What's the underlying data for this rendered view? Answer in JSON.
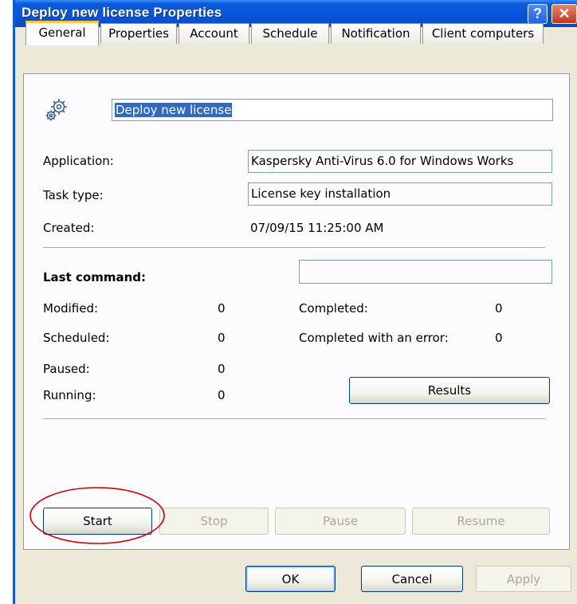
{
  "window": {
    "title": "Deploy new license Properties",
    "help_label": "?",
    "close_label": "✕"
  },
  "tabs": [
    {
      "label": "General",
      "active": true
    },
    {
      "label": "Properties"
    },
    {
      "label": "Account"
    },
    {
      "label": "Schedule"
    },
    {
      "label": "Notification"
    },
    {
      "label": "Client computers"
    }
  ],
  "general": {
    "task_name": "Deploy new license",
    "application_label": "Application:",
    "application_value": "Kaspersky Anti-Virus 6.0 for Windows Works",
    "task_type_label": "Task type:",
    "task_type_value": "License key installation",
    "created_label": "Created:",
    "created_value": "07/09/15 11:25:00 AM"
  },
  "last_command": {
    "label": "Last command:",
    "value": ""
  },
  "stats": {
    "modified_label": "Modified:",
    "modified_value": "0",
    "scheduled_label": "Scheduled:",
    "scheduled_value": "0",
    "paused_label": "Paused:",
    "paused_value": "0",
    "running_label": "Running:",
    "running_value": "0",
    "completed_label": "Completed:",
    "completed_value": "0",
    "completed_error_label": "Completed with an error:",
    "completed_error_value": "0"
  },
  "buttons": {
    "results": "Results",
    "start": "Start",
    "stop": "Stop",
    "pause": "Pause",
    "resume": "Resume",
    "ok": "OK",
    "cancel": "Cancel",
    "apply": "Apply"
  },
  "colors": {
    "titlebar": "#0a5ad9",
    "dialog_bg": "#ece9d8",
    "highlight_ellipse": "#d40000",
    "selection": "#316ac5"
  },
  "icons": {
    "task_icon": "gears-icon"
  }
}
